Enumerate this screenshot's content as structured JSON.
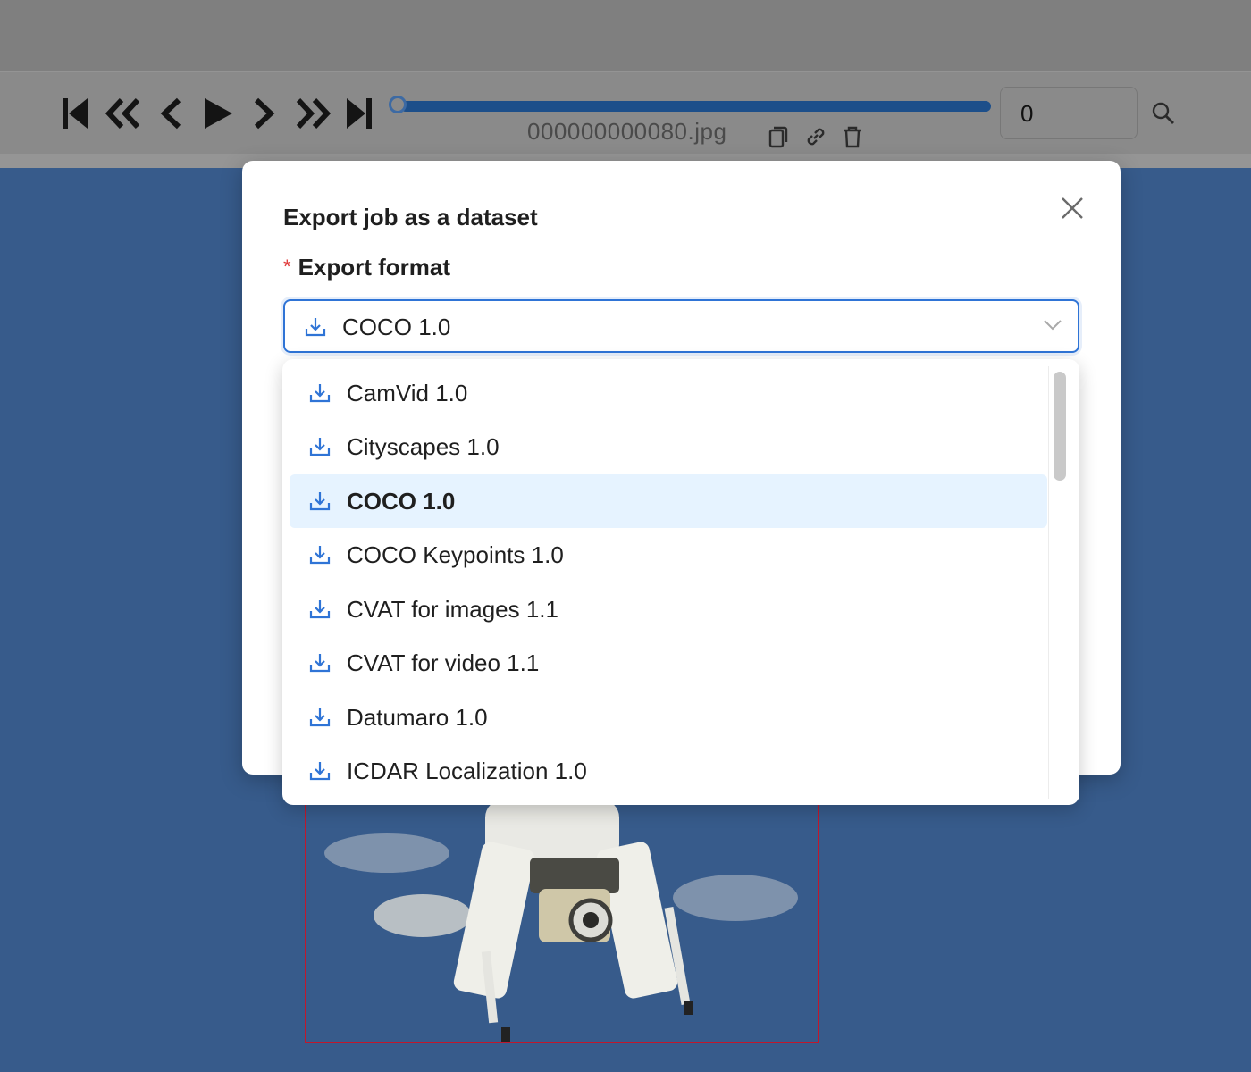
{
  "player": {
    "filename": "000000000080.jpg",
    "frame_value": "0",
    "progress": 0,
    "icons": [
      "first-frame-icon",
      "backward-step-icon",
      "previous-frame-icon",
      "play-icon",
      "next-frame-icon",
      "forward-step-icon",
      "last-frame-icon",
      "copy-icon",
      "link-icon",
      "delete-icon",
      "search-icon"
    ]
  },
  "modal": {
    "title": "Export job as a dataset",
    "close_icon": "close-icon",
    "field_label": "Export format",
    "required_mark": "*",
    "selected_format": "COCO 1.0",
    "options": [
      {
        "label": "CamVid 1.0",
        "selected": false
      },
      {
        "label": "Cityscapes 1.0",
        "selected": false
      },
      {
        "label": "COCO 1.0",
        "selected": true
      },
      {
        "label": "COCO Keypoints 1.0",
        "selected": false
      },
      {
        "label": "CVAT for images 1.1",
        "selected": false
      },
      {
        "label": "CVAT for video 1.1",
        "selected": false
      },
      {
        "label": "Datumaro 1.0",
        "selected": false
      },
      {
        "label": "ICDAR Localization 1.0",
        "selected": false
      }
    ]
  },
  "colors": {
    "accent": "#2f74d6",
    "selected_bg": "#e6f3ff",
    "required": "#e03a3a",
    "bbox": "#c0182d",
    "canvas_bg": "#375b8b"
  }
}
